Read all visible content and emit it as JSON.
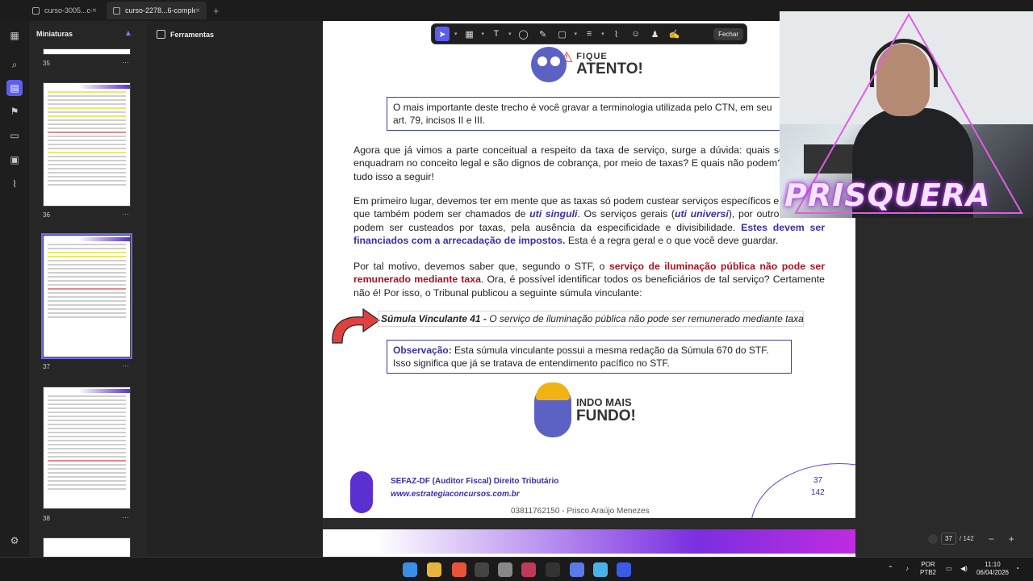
{
  "tabs": [
    {
      "label": "curso-3005...c-completo",
      "close": "×",
      "active": false
    },
    {
      "label": "curso-2278...6-completo",
      "close": "×",
      "active": true
    }
  ],
  "tab_add": "+",
  "thumbnails": {
    "header": "Miniaturas",
    "pages": [
      "35",
      "36",
      "37",
      "38"
    ],
    "more": "···"
  },
  "tools_panel": {
    "header": "Ferramentas"
  },
  "annotation_toolbar": {
    "close_label": "Fechar"
  },
  "document": {
    "badge_small": "FIQUE",
    "badge_large": "ATENTO!",
    "box1": "O mais importante deste trecho é você gravar a terminologia utilizada pelo CTN, em seu art. 79, incisos II e III.",
    "p1": "Agora que já vimos a parte conceitual a respeito da taxa de serviço, surge a dúvida: quais serviços se enquadram no conceito legal e são dignos de cobrança, por meio de taxas? E quais não podem? Veremos tudo isso a seguir!",
    "p2_a": "Em primeiro lugar, devemos ter em mente que as taxas só podem custear serviços específicos e divisíveis, que também podem ser chamados de ",
    "p2_b": "uti singuli",
    "p2_c": ". Os serviços gerais (",
    "p2_d": "uti universi",
    "p2_e": "), por outro lado, não podem ser custeados por taxas, pela ausência da especificidade e divisibilidade. ",
    "p2_f": "Estes devem ser financiados com a arrecadação de impostos.",
    "p2_g": " Esta é a regra geral e o que você deve guardar.",
    "p3_a": "Por tal motivo, devemos saber que, segundo o STF, o ",
    "p3_b": "serviço de iluminação pública não pode ser remunerado mediante taxa",
    "p3_c": ". Ora, é possível identificar todos os beneficiários de tal serviço? Certamente não é! Por isso, o Tribunal publicou a seguinte súmula vinculante:",
    "sumula_title": "Súmula Vinculante 41 -",
    "sumula_text": " O serviço de iluminação pública não pode ser remunerado mediante taxa",
    "obs_label": "Observação:",
    "obs_text": " Esta súmula vinculante possui a mesma redação da Súmula 670 do STF. Isso significa que já se tratava de entendimento pacífico no STF.",
    "indo_small": "INDO MAIS",
    "indo_large": "FUNDO!",
    "footer_title": "SEFAZ-DF (Auditor Fiscal) Direito Tributário",
    "footer_site": "www.estrategiaconcursos.com.br",
    "page_current": "37",
    "page_total": "142",
    "watermark": "03811762150 - Prisco Araújo Menezes"
  },
  "overlay": {
    "brand": "PRISQUERA"
  },
  "page_nav": {
    "current": "37",
    "total": "/ 142",
    "minus": "−",
    "plus": "+"
  },
  "thumb_nav": {
    "prev": "‹",
    "more": "···",
    "next": "›"
  },
  "taskbar": {
    "lang_top": "POR",
    "lang_bottom": "PTB2",
    "time": "11:10",
    "date": "06/04/2026"
  },
  "colors": {
    "accent": "#5b5ef0",
    "doc_blue": "#3a2fa8",
    "doc_red": "#b0101d"
  }
}
